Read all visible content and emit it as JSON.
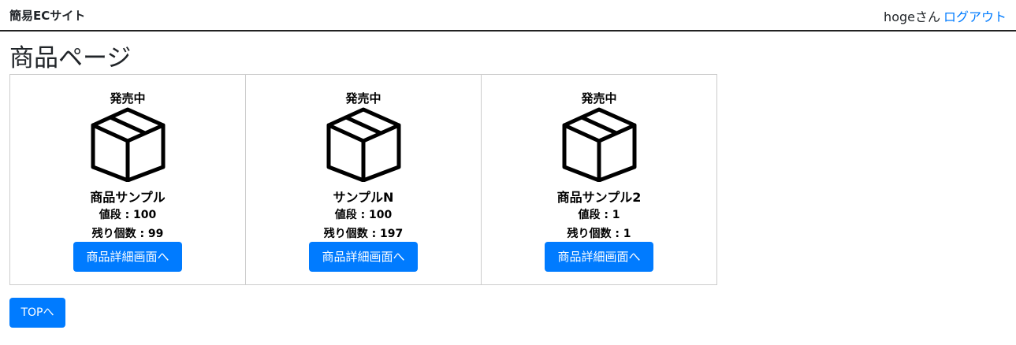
{
  "header": {
    "brand": "簡易ECサイト",
    "user_greeting": "hogeさん",
    "logout_label": "ログアウト"
  },
  "page": {
    "title": "商品ページ"
  },
  "products": [
    {
      "status": "発売中",
      "icon": "box-icon",
      "name": "商品サンプル",
      "price": "値段 : 100",
      "stock": "残り個数 : 99",
      "button_label": "商品詳細画面へ"
    },
    {
      "status": "発売中",
      "icon": "box-icon",
      "name": "サンプルN",
      "price": "値段 : 100",
      "stock": "残り個数 : 197",
      "button_label": "商品詳細画面へ"
    },
    {
      "status": "発売中",
      "icon": "box-icon",
      "name": "商品サンプル2",
      "price": "値段 : 1",
      "stock": "残り個数 : 1",
      "button_label": "商品詳細画面へ"
    }
  ],
  "footer": {
    "top_button_label": "TOPへ"
  },
  "colors": {
    "accent": "#007bff",
    "card_border": "#cccccc",
    "nav_border": "#222222"
  }
}
